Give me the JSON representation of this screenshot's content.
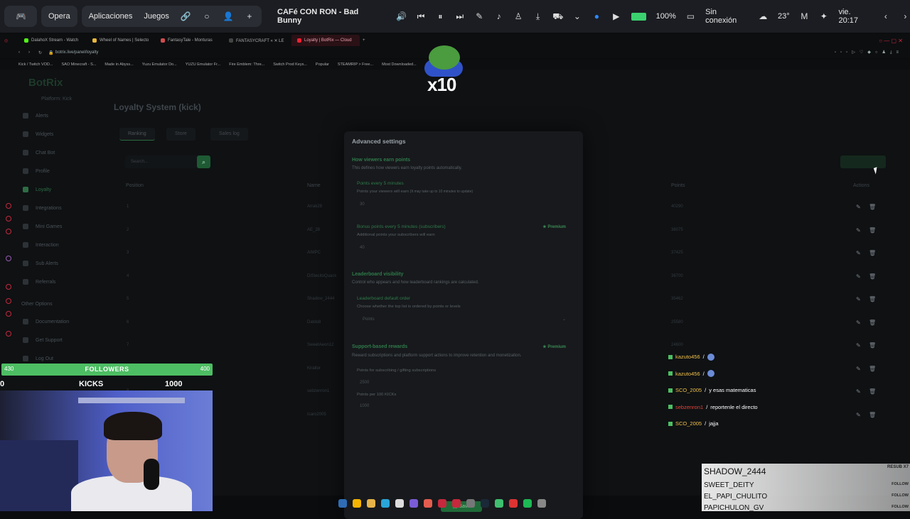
{
  "topbar": {
    "browser_label": "Opera",
    "apps_label": "Aplicaciones",
    "games_label": "Juegos",
    "song": "CAFé CON RON - Bad Bunny",
    "battery": "100%",
    "network": "Sin conexión",
    "temperature": "23°",
    "clock": "vie. 20:17"
  },
  "tabs": [
    {
      "label": "DalahoX Stream - Watch"
    },
    {
      "label": "Wheel of Names | Selecto"
    },
    {
      "label": "FantasyTale - Monturas"
    },
    {
      "label": "FANTASYCRAFT « ✕ LE"
    },
    {
      "label": "Loyalty | BotRix — Cloud"
    }
  ],
  "address": "botrix.live/panel/loyalty",
  "bookmarks": [
    "Kick / Twitch VOD...",
    "SAO Minecraft - S...",
    "Made in Abyss...",
    "Yuzu Emulator Do...",
    "YUZU Emulator Fr...",
    "Fire Emblem: Thre...",
    "Switch Prod Keys...",
    "Popular",
    "STEAMRIP > Free...",
    "Most Downloaded..."
  ],
  "sidebar": {
    "brand": "BotRix",
    "platform": "Platform: Kick",
    "items": [
      "Alerts",
      "Widgets",
      "Chat Bot",
      "Profile",
      "Loyalty",
      "Integrations",
      "Mini Games",
      "Interaction",
      "Sub Alerts",
      "Referrals",
      "Other Options",
      "Documentation",
      "Get Support",
      "Log Out"
    ]
  },
  "main": {
    "heading": "Loyalty System (kick)",
    "tabs": [
      "Ranking",
      "Store",
      "Sales log"
    ],
    "search_placeholder": "Search...",
    "columns": {
      "position": "Position",
      "name": "Name",
      "level": "Level",
      "points": "Points",
      "actions": "Actions"
    },
    "rows": [
      {
        "pos": "1",
        "name": "Arrak28",
        "points": "40290"
      },
      {
        "pos": "2",
        "name": "AE_28",
        "points": "38075"
      },
      {
        "pos": "3",
        "name": "AIMPC",
        "points": "37425"
      },
      {
        "pos": "4",
        "name": "DiStecitoQuack",
        "points": "36700"
      },
      {
        "pos": "5",
        "name": "Shadow_2444",
        "points": "35462"
      },
      {
        "pos": "6",
        "name": "Datdo8",
        "points": "25580"
      },
      {
        "pos": "7",
        "name": "SweetAeon12",
        "points": "24600"
      },
      {
        "pos": "8",
        "name": "Kiraltor",
        "points": ""
      },
      {
        "pos": "9",
        "name": "sebzenron1",
        "points": ""
      },
      {
        "pos": "10",
        "name": "Icaro2005",
        "points": ""
      }
    ]
  },
  "modal": {
    "title": "Advanced settings",
    "earn_title": "How viewers earn points",
    "earn_desc": "This defines how viewers earn loyalty points automatically.",
    "points5_label": "Points every 5 minutes",
    "points5_desc": "Points your viewers will earn",
    "points5_note": "(It may take up to 10 minutes to update)",
    "points5_value": "30",
    "bonus_label": "Bonus points every 5 minutes (subscribers)",
    "bonus_desc": "Additional points your subscribers will earn",
    "bonus_value": "40",
    "premium": "Premium",
    "visibility_title": "Leaderboard visibility",
    "visibility_desc": "Control who appears and how leaderboard rankings are calculated.",
    "order_label": "Leaderboard default order",
    "order_desc": "Choose whether the top list is ordered by points or levels",
    "order_value": "Points",
    "support_title": "Support-based rewards",
    "support_desc": "Reward subscriptions and platform support actions to improve retention and monetization.",
    "subs_label": "Points for subscribing / gifting subscriptions",
    "subs_value": "2500",
    "kicks_label": "Points per 100 KICKs",
    "kicks_value": "1000",
    "save": "Save"
  },
  "overlay": {
    "emote_multiplier": "x10",
    "followers_label": "FOLLOWERS",
    "followers_left": "430",
    "followers_right": "400",
    "kicks_left": "0",
    "kicks_label": "KICKS",
    "kicks_goal": "1000",
    "chat": [
      {
        "user": "kazuto456",
        "msg": ""
      },
      {
        "user": "kazuto456",
        "msg": ""
      },
      {
        "user": "SCO_2005",
        "msg": "y esas matematicas"
      },
      {
        "user": "sebzenron1",
        "msg": "reportenle el directo"
      },
      {
        "user": "SCO_2005",
        "msg": "jajja"
      }
    ],
    "recent_top": "SHADOW_2444",
    "recent_tag": "RESUB X7",
    "recent": [
      "SWEET_DEITY",
      "EL_PAPI_CHULITO",
      "PAPICHULON_GV"
    ],
    "follow_label": "FOLLOW"
  },
  "colors": {
    "accent": "#4dbe63",
    "brand_green": "#2f7a4a",
    "opera_red": "#c6283d"
  }
}
